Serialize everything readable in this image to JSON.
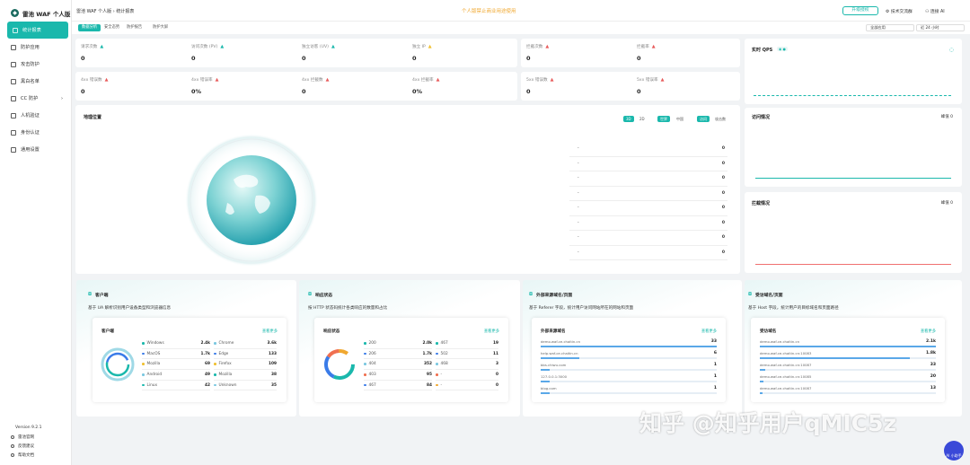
{
  "brand": {
    "name": "雷池 WAF 个人版"
  },
  "sidebar": {
    "items": [
      {
        "label": "统计报表",
        "active": true
      },
      {
        "label": "防护应用"
      },
      {
        "label": "攻击防护"
      },
      {
        "label": "黑白名单"
      },
      {
        "label": "CC 防护",
        "caret": "›"
      },
      {
        "label": "人机验证"
      },
      {
        "label": "身份认证"
      },
      {
        "label": "通用设置"
      }
    ],
    "version": "Version 9.2.1",
    "footer": [
      "雷池官网",
      "反馈建议",
      "帮助文档"
    ]
  },
  "topbar": {
    "breadcrumb": "雷池 WAF 个人版  ›  统计报表",
    "notice": "个人版禁止商业用途使用",
    "upgrade": "升级授权",
    "tech": "技术交流群",
    "ai": "连接 AI"
  },
  "tabs": {
    "items": [
      "数据分析",
      "安全态势",
      "防护报告",
      "防护大屏"
    ],
    "site_select": "全部应用",
    "time_select": "近 24 小时"
  },
  "stats_row1": [
    {
      "label": "请求次数",
      "value": "0",
      "color": "#1ab8ac"
    },
    {
      "label": "访问次数 (PV)",
      "value": "0",
      "color": "#1ab8ac"
    },
    {
      "label": "独立访客 (UV)",
      "value": "0",
      "color": "#1ab8ac"
    },
    {
      "label": "独立 IP",
      "value": "0",
      "color": "#f0c030"
    }
  ],
  "stats_row1b": [
    {
      "label": "拦截次数",
      "value": "0"
    },
    {
      "label": "拦截率",
      "value": "0"
    }
  ],
  "stats_row2": [
    {
      "label": "4xx 错误数",
      "value": "0"
    },
    {
      "label": "4xx 错误率",
      "value": "0%"
    },
    {
      "label": "4xx 拦截数",
      "value": "0"
    },
    {
      "label": "4xx 拦截率",
      "value": "0%"
    }
  ],
  "stats_row2b": [
    {
      "label": "5xx 错误数",
      "value": "0"
    },
    {
      "label": "5xx 错误率",
      "value": "0"
    }
  ],
  "qps": {
    "title": "实时 QPS"
  },
  "geo": {
    "title": "地理位置",
    "btn_2d": "3D",
    "btn_2d_b": "2D",
    "btn_world": "世界",
    "btn_cn": "中国",
    "btn_visit": "访问",
    "btn_block": "攻击数",
    "rows": [
      {
        "name": "-",
        "value": "0"
      },
      {
        "name": "-",
        "value": "0"
      },
      {
        "name": "-",
        "value": "0"
      },
      {
        "name": "-",
        "value": "0"
      },
      {
        "name": "-",
        "value": "0"
      },
      {
        "name": "-",
        "value": "0"
      },
      {
        "name": "-",
        "value": "0"
      },
      {
        "name": "-",
        "value": "0"
      }
    ]
  },
  "visit": {
    "title": "访问情况",
    "right": "峰值  0"
  },
  "block": {
    "title": "拦截情况",
    "right": "峰值  0"
  },
  "client": {
    "title": "客户端",
    "desc": "基于 UA 解析识别用户设备类型和浏览器信息",
    "inner_title": "客户端",
    "more": "查看更多",
    "left": [
      {
        "name": "Windows",
        "value": "2.4k",
        "color": "#1ab8ac"
      },
      {
        "name": "MacOS",
        "value": "1.7k",
        "color": "#3a7be8"
      },
      {
        "name": "Mozilla",
        "value": "69",
        "color": "#f0c030"
      },
      {
        "name": "Android",
        "value": "49",
        "color": "#7ac7e0"
      },
      {
        "name": "Linux",
        "value": "42",
        "color": "#1ab8ac"
      }
    ],
    "right": [
      {
        "name": "Chrome",
        "value": "3.6k",
        "color": "#7ac7e0"
      },
      {
        "name": "Edge",
        "value": "133",
        "color": "#3a7be8"
      },
      {
        "name": "Firefox",
        "value": "109",
        "color": "#f0c030"
      },
      {
        "name": "Mozilla",
        "value": "38",
        "color": "#1ab8ac"
      },
      {
        "name": "Unknown",
        "value": "35",
        "color": "#7ac7e0"
      }
    ]
  },
  "status": {
    "title": "响应状态",
    "desc": "按 HTTP 状态码统计各类响应的数量和占比",
    "inner_title": "响应状态",
    "more": "查看更多",
    "left": [
      {
        "name": "200",
        "value": "2.0k",
        "color": "#1ab8ac"
      },
      {
        "name": "206",
        "value": "1.7k",
        "color": "#3a7be8"
      },
      {
        "name": "404",
        "value": "352",
        "color": "#7ac7e0"
      },
      {
        "name": "403",
        "value": "95",
        "color": "#f07050"
      },
      {
        "name": "467",
        "value": "84",
        "color": "#3a7be8"
      }
    ],
    "right": [
      {
        "name": "467",
        "value": "19",
        "color": "#1ab8ac"
      },
      {
        "name": "502",
        "value": "11",
        "color": "#3a7be8"
      },
      {
        "name": "468",
        "value": "3",
        "color": "#7ac7e0"
      },
      {
        "name": "-",
        "value": "0",
        "color": "#f07050"
      },
      {
        "name": "-",
        "value": "0",
        "color": "#f0a830"
      }
    ]
  },
  "referer": {
    "title": "外部来源域名/页面",
    "desc": "基于 Referer 字段，统计用户访问网站所在的网站和页面",
    "inner_title": "外部来源域名",
    "more": "查看更多",
    "rows": [
      {
        "name": "demo.waf-ce.chaitin.cn",
        "value": "33",
        "pct": 1
      },
      {
        "name": "help.waf-ce.chaitin.cn",
        "value": "6",
        "pct": 0.22
      },
      {
        "name": "bbs.chiwu.com",
        "value": "1",
        "pct": 0.05
      },
      {
        "name": "127.0.0.1:3000",
        "value": "1",
        "pct": 0.05
      },
      {
        "name": "blog.com",
        "value": "1",
        "pct": 0.05
      }
    ]
  },
  "host": {
    "title": "受访域名/页面",
    "desc": "基于 Host 字段，统计用户的目标域名和页面路径",
    "inner_title": "受访域名",
    "more": "查看更多",
    "rows": [
      {
        "name": "demo.waf-ce.chaitin.cn",
        "value": "2.1k",
        "pct": 1
      },
      {
        "name": "demo.waf-ce.chaitin.cn:10083",
        "value": "1.8k",
        "pct": 0.85
      },
      {
        "name": "demo.waf-ce.chaitin.cn:10087",
        "value": "33",
        "pct": 0.03
      },
      {
        "name": "demo.waf-ce.chaitin.cn:10085",
        "value": "20",
        "pct": 0.02
      },
      {
        "name": "demo.waf-ce.chaitin.cn:10087",
        "value": "13",
        "pct": 0.015
      }
    ]
  },
  "watermark": "知乎 @知乎用户qMIC5z",
  "ai_button": "AI 小助手"
}
